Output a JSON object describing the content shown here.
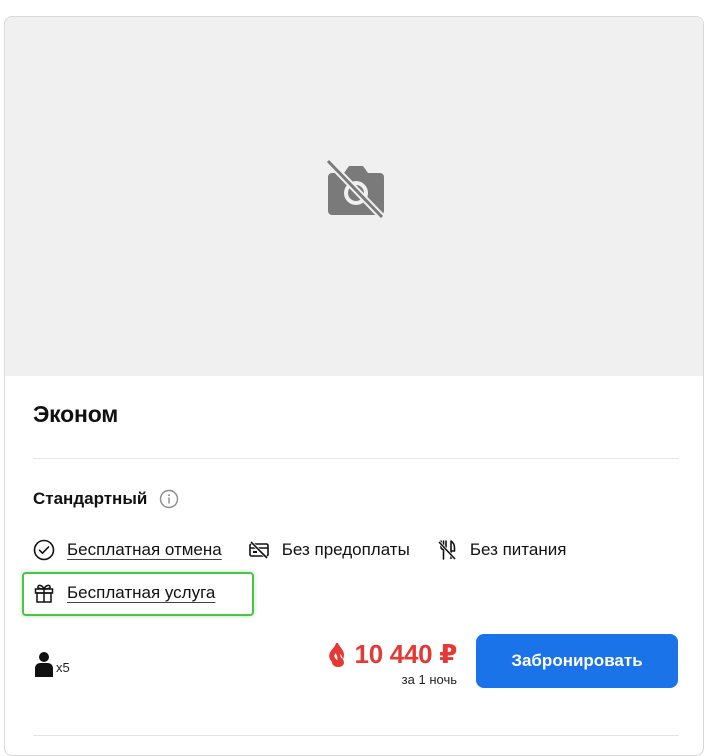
{
  "room": {
    "title": "Эконом"
  },
  "tariff": {
    "name": "Стандартный",
    "info_icon": "info-icon"
  },
  "features": [
    {
      "label": "Бесплатная отмена",
      "icon": "check-circle-icon",
      "link": true
    },
    {
      "label": "Без предоплаты",
      "icon": "no-card-icon",
      "link": false
    },
    {
      "label": "Без питания",
      "icon": "no-food-icon",
      "link": false
    }
  ],
  "gift": {
    "label": "Бесплатная услуга",
    "icon": "gift-icon"
  },
  "guests": {
    "icon": "person-icon",
    "count": "x5"
  },
  "price": {
    "value": "10 440 ₽",
    "note": "за 1 ночь",
    "icon": "fire-icon"
  },
  "actions": {
    "book_label": "Забронировать"
  },
  "colors": {
    "accent": "#1a73e8",
    "price": "#e53935",
    "highlight": "#4cc24a",
    "photo_bg": "#f0f0f0"
  }
}
